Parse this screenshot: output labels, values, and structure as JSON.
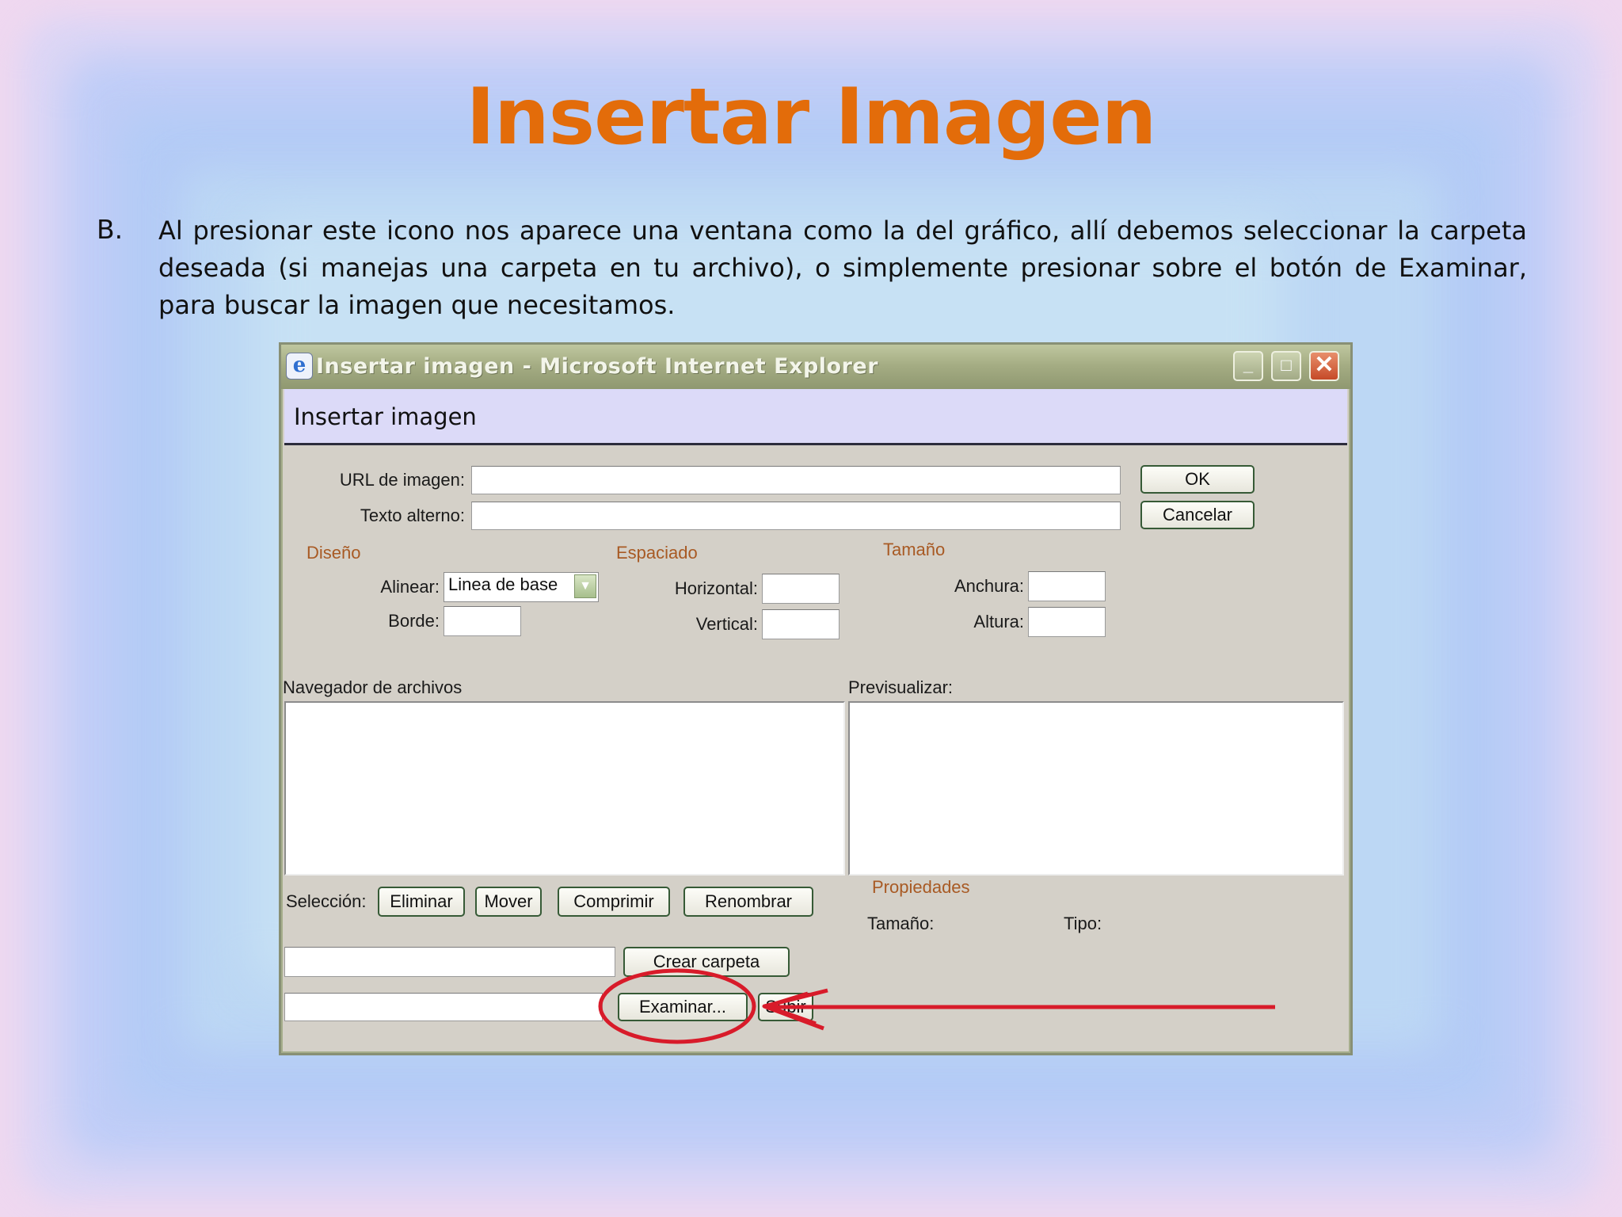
{
  "slide": {
    "title": "Insertar Imagen",
    "bullet_marker": "B.",
    "bullet_text": "Al presionar este icono nos aparece una ventana como la del gráfico, allí debemos seleccionar la carpeta deseada (si manejas una carpeta en tu archivo), o simplemente presionar sobre el botón de Examinar, para buscar la imagen que necesitamos."
  },
  "window": {
    "titlebar_icon": "e",
    "title": "Insertar imagen - Microsoft Internet Explorer",
    "controls": {
      "minimize": "_",
      "maximize": "□",
      "close": "✕"
    },
    "header": "Insertar imagen"
  },
  "form": {
    "url_label": "URL de imagen:",
    "url_value": "",
    "alt_label": "Texto alterno:",
    "alt_value": "",
    "ok_label": "OK",
    "cancel_label": "Cancelar"
  },
  "design": {
    "section": "Diseño",
    "align_label": "Alinear:",
    "align_value": "Linea de base",
    "border_label": "Borde:",
    "border_value": ""
  },
  "spacing": {
    "section": "Espaciado",
    "horizontal_label": "Horizontal:",
    "horizontal_value": "",
    "vertical_label": "Vertical:",
    "vertical_value": ""
  },
  "size": {
    "section": "Tamaño",
    "width_label": "Anchura:",
    "width_value": "",
    "height_label": "Altura:",
    "height_value": ""
  },
  "browser": {
    "label": "Navegador de archivos",
    "preview_label": "Previsualizar:",
    "selection_label": "Selección:",
    "delete_label": "Eliminar",
    "move_label": "Mover",
    "compress_label": "Comprimir",
    "rename_label": "Renombrar",
    "create_folder_label": "Crear carpeta",
    "create_folder_value": "",
    "browse_label": "Examinar...",
    "upload_label": "Subir",
    "upload_path_value": ""
  },
  "properties": {
    "section": "Propiedades",
    "size_label": "Tamaño:",
    "type_label": "Tipo:"
  },
  "colors": {
    "title_orange": "#e36c0a",
    "section_brown": "#a85a24",
    "annotation_red": "#d81b2a"
  }
}
